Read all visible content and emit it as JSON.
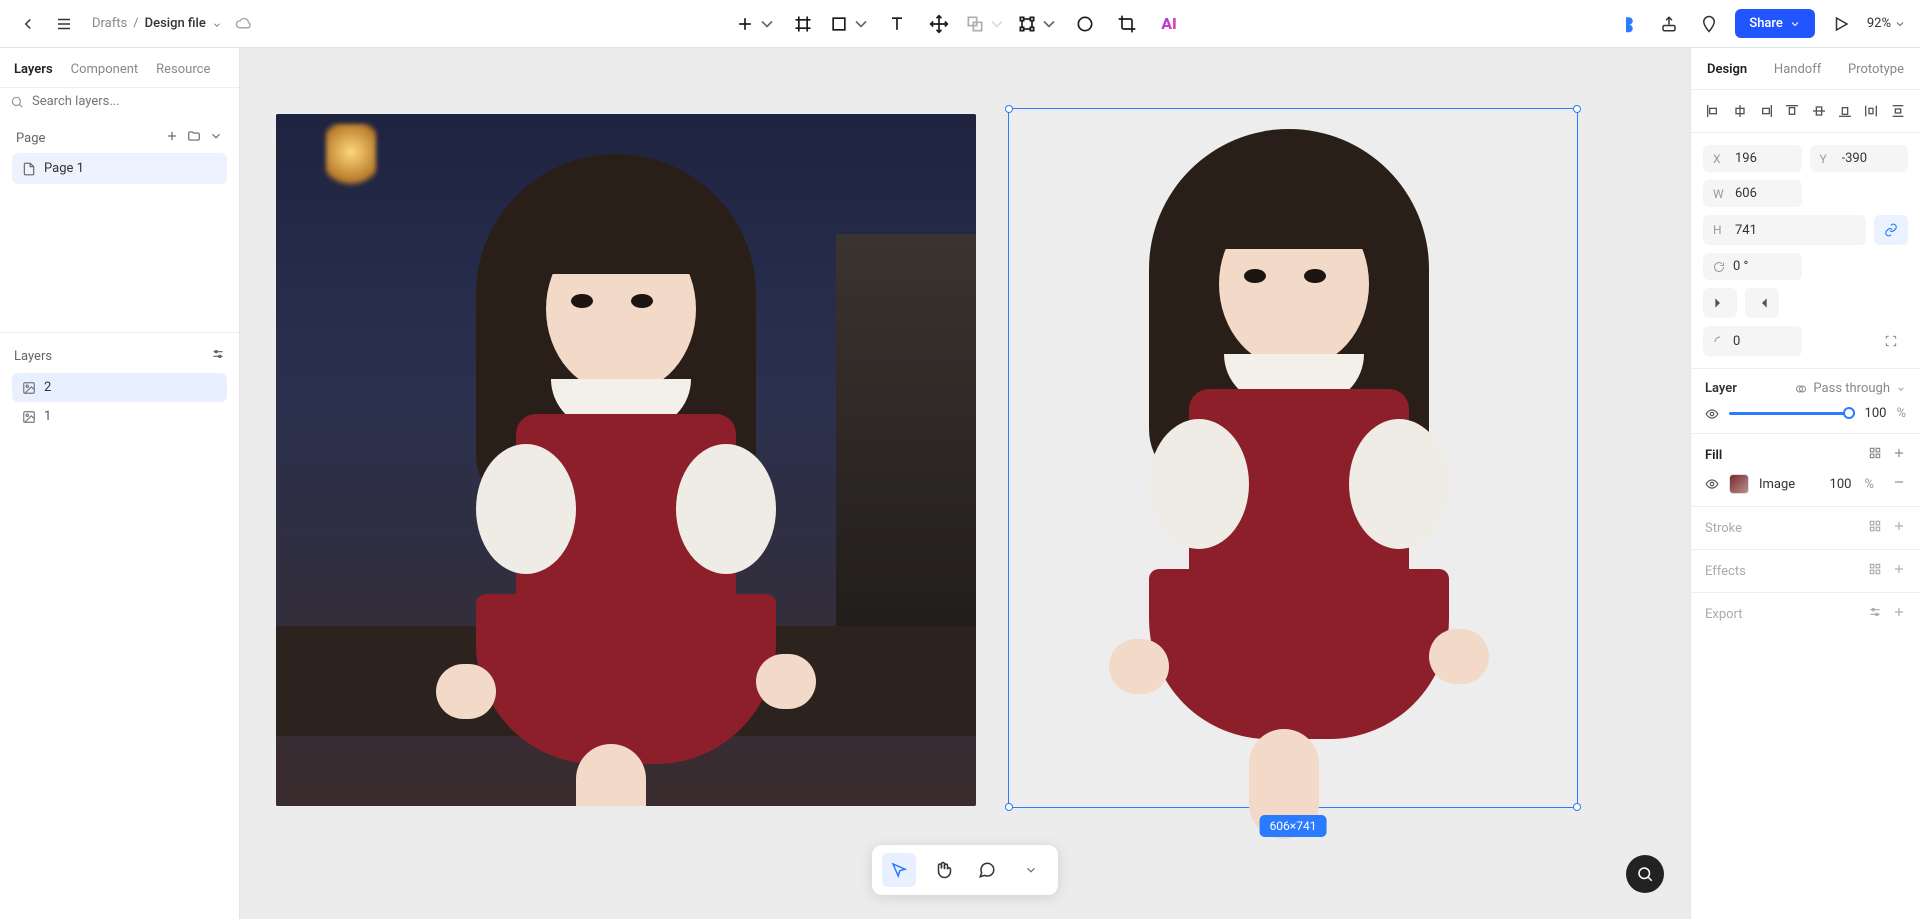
{
  "topbar": {
    "breadcrumb_root": "Drafts",
    "breadcrumb_separator": "/",
    "breadcrumb_current": "Design file",
    "share_label": "Share",
    "zoom_label": "92%"
  },
  "left_panel": {
    "tabs": {
      "layers": "Layers",
      "component": "Component",
      "resource": "Resource"
    },
    "search_placeholder": "Search layers...",
    "page_section_label": "Page",
    "pages": [
      {
        "name": "Page 1"
      }
    ],
    "layers_section_label": "Layers",
    "layers": [
      {
        "name": "2"
      },
      {
        "name": "1"
      }
    ]
  },
  "canvas": {
    "selection_badge": "606×741"
  },
  "right_panel": {
    "tabs": {
      "design": "Design",
      "handoff": "Handoff",
      "prototype": "Prototype"
    },
    "dims": {
      "x_label": "X",
      "x_value": "196",
      "y_label": "Y",
      "y_value": "-390",
      "w_label": "W",
      "w_value": "606",
      "h_label": "H",
      "h_value": "741",
      "rotate_value": "0 °",
      "radius_value": "0"
    },
    "layer_section": {
      "title": "Layer",
      "blend_label": "Pass through",
      "opacity_value": "100",
      "opacity_unit": "%"
    },
    "fill_section": {
      "title": "Fill",
      "item_label": "Image",
      "item_opacity": "100",
      "item_unit": "%"
    },
    "stroke_section": {
      "title": "Stroke"
    },
    "effects_section": {
      "title": "Effects"
    },
    "export_section": {
      "title": "Export"
    }
  }
}
